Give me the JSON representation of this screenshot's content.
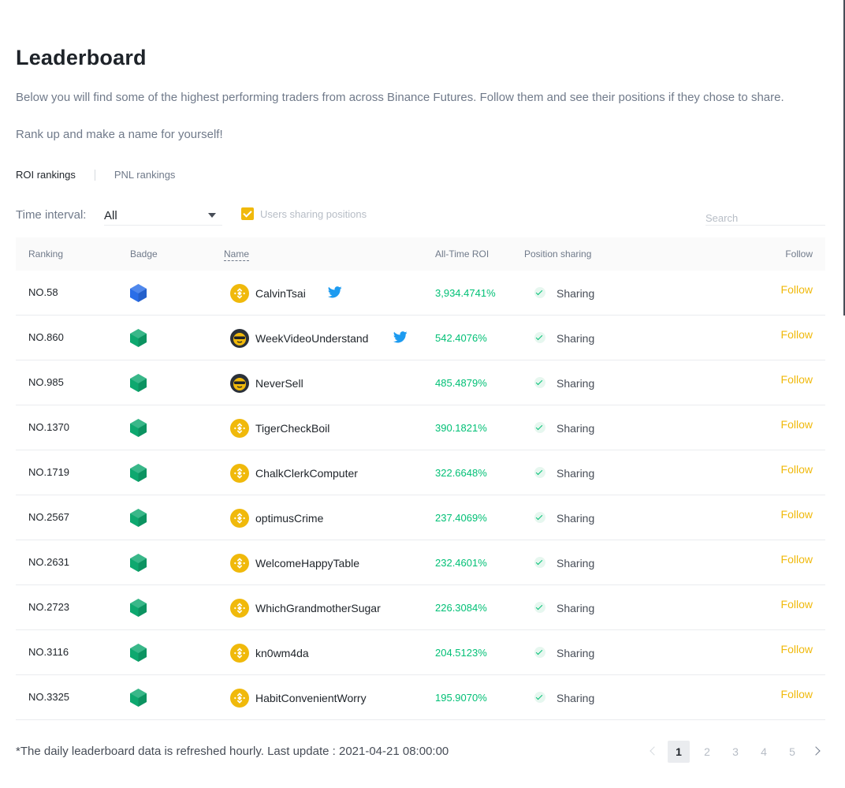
{
  "header": {
    "title": "Leaderboard",
    "description": "Below you will find some of the highest performing traders from across Binance Futures. Follow them and see their positions if they chose to share.",
    "subtitle": "Rank up and make a name for yourself!"
  },
  "tabs": [
    {
      "label": "ROI rankings",
      "active": true
    },
    {
      "label": "PNL rankings",
      "active": false
    }
  ],
  "filters": {
    "time_interval_label": "Time interval:",
    "time_interval_value": "All",
    "sharing_checkbox_label": "Users sharing positions",
    "sharing_checked": true,
    "search_placeholder": "Search"
  },
  "columns": {
    "ranking": "Ranking",
    "badge": "Badge",
    "name": "Name",
    "roi": "All-Time ROI",
    "sharing": "Position sharing",
    "follow": "Follow"
  },
  "colors": {
    "accent": "#f0b90b",
    "positive": "#02c076",
    "badge_blue": "#2a6ee8",
    "badge_green": "#0ea86f"
  },
  "rows": [
    {
      "rank": "NO.58",
      "badge": "blue-hexagon-icon",
      "avatar": "binance-coin-icon",
      "name": "CalvinTsai",
      "twitter": true,
      "roi": "3,934.4741%",
      "sharing": "Sharing",
      "follow": "Follow"
    },
    {
      "rank": "NO.860",
      "badge": "green-hexagon-icon",
      "avatar": "sunglasses-avatar-icon",
      "name": "WeekVideoUnderstand",
      "twitter": true,
      "roi": "542.4076%",
      "sharing": "Sharing",
      "follow": "Follow"
    },
    {
      "rank": "NO.985",
      "badge": "green-hexagon-icon",
      "avatar": "sunglasses-avatar-icon",
      "name": "NeverSell",
      "twitter": false,
      "roi": "485.4879%",
      "sharing": "Sharing",
      "follow": "Follow"
    },
    {
      "rank": "NO.1370",
      "badge": "green-hexagon-icon",
      "avatar": "binance-coin-icon",
      "name": "TigerCheckBoil",
      "twitter": false,
      "roi": "390.1821%",
      "sharing": "Sharing",
      "follow": "Follow"
    },
    {
      "rank": "NO.1719",
      "badge": "green-hexagon-icon",
      "avatar": "binance-coin-icon",
      "name": "ChalkClerkComputer",
      "twitter": false,
      "roi": "322.6648%",
      "sharing": "Sharing",
      "follow": "Follow"
    },
    {
      "rank": "NO.2567",
      "badge": "green-hexagon-icon",
      "avatar": "binance-coin-icon",
      "name": "optimusCrime",
      "twitter": false,
      "roi": "237.4069%",
      "sharing": "Sharing",
      "follow": "Follow"
    },
    {
      "rank": "NO.2631",
      "badge": "green-hexagon-icon",
      "avatar": "binance-coin-icon",
      "name": "WelcomeHappyTable",
      "twitter": false,
      "roi": "232.4601%",
      "sharing": "Sharing",
      "follow": "Follow"
    },
    {
      "rank": "NO.2723",
      "badge": "green-hexagon-icon",
      "avatar": "binance-coin-icon",
      "name": "WhichGrandmotherSugar",
      "twitter": false,
      "roi": "226.3084%",
      "sharing": "Sharing",
      "follow": "Follow"
    },
    {
      "rank": "NO.3116",
      "badge": "green-hexagon-icon",
      "avatar": "binance-coin-icon",
      "name": "kn0wm4da",
      "twitter": false,
      "roi": "204.5123%",
      "sharing": "Sharing",
      "follow": "Follow"
    },
    {
      "rank": "NO.3325",
      "badge": "green-hexagon-icon",
      "avatar": "binance-coin-icon",
      "name": "HabitConvenientWorry",
      "twitter": false,
      "roi": "195.9070%",
      "sharing": "Sharing",
      "follow": "Follow"
    }
  ],
  "footer": {
    "note": "*The daily leaderboard data is refreshed hourly. Last update : 2021-04-21 08:00:00"
  },
  "pagination": {
    "pages": [
      "1",
      "2",
      "3",
      "4",
      "5"
    ],
    "current": "1"
  }
}
